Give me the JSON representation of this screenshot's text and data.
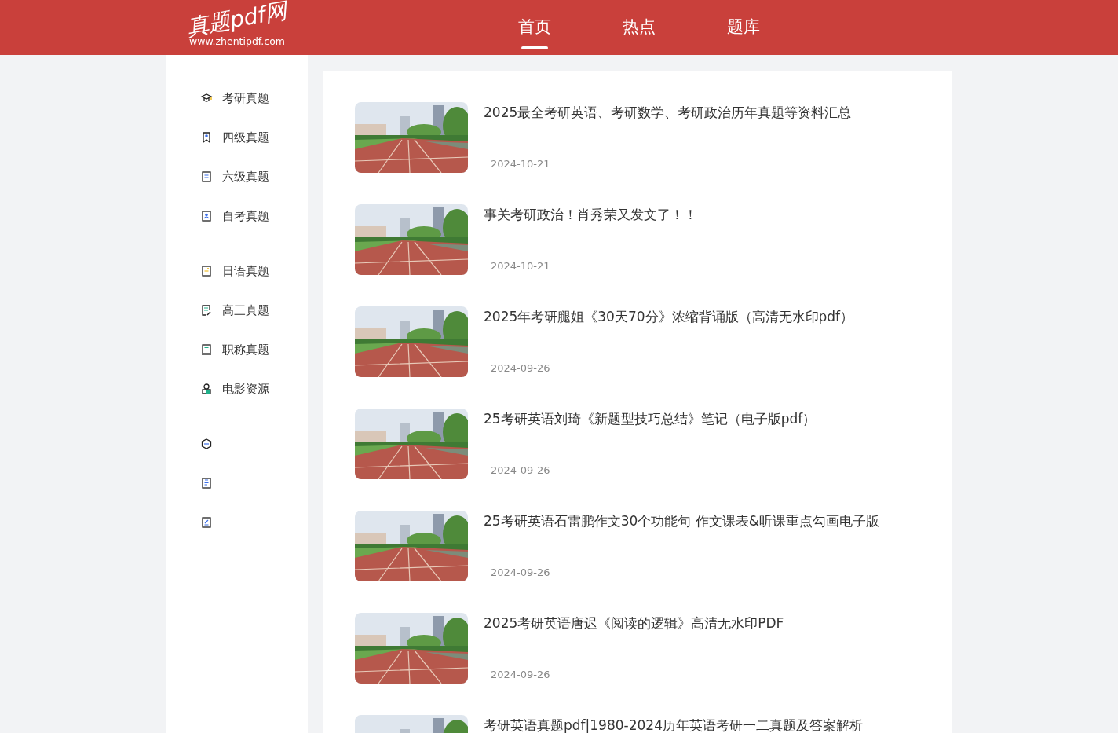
{
  "header": {
    "logo": {
      "title": "真题pdf网",
      "url": "www.zhentipdf.com"
    },
    "nav": [
      {
        "label": "首页",
        "selected": true
      },
      {
        "label": "热点",
        "selected": false
      },
      {
        "label": "题库",
        "selected": false
      }
    ]
  },
  "sidebar": {
    "groups": [
      [
        {
          "label": "考研真题"
        },
        {
          "label": "四级真题"
        },
        {
          "label": "六级真题"
        },
        {
          "label": "自考真题"
        }
      ],
      [
        {
          "label": "日语真题"
        },
        {
          "label": "高三真题"
        },
        {
          "label": "职称真题"
        },
        {
          "label": "电影资源"
        }
      ]
    ]
  },
  "articles": [
    {
      "title": "2025最全考研英语、考研数学、考研政治历年真题等资料汇总",
      "date": "2024-10-21"
    },
    {
      "title": "事关考研政治！肖秀荣又发文了！！",
      "date": "2024-10-21"
    },
    {
      "title": "2025年考研腿姐《30天70分》浓缩背诵版（高清无水印pdf）",
      "date": "2024-09-26"
    },
    {
      "title": "25考研英语刘琦《新题型技巧总结》笔记（电子版pdf）",
      "date": "2024-09-26"
    },
    {
      "title": "25考研英语石雷鹏作文30个功能句 作文课表&听课重点勾画电子版",
      "date": "2024-09-26"
    },
    {
      "title": "2025考研英语唐迟《阅读的逻辑》高清无水印PDF",
      "date": "2024-09-26"
    },
    {
      "title": "考研英语真题pdf|1980-2024历年英语考研一二真题及答案解析"
    }
  ]
}
